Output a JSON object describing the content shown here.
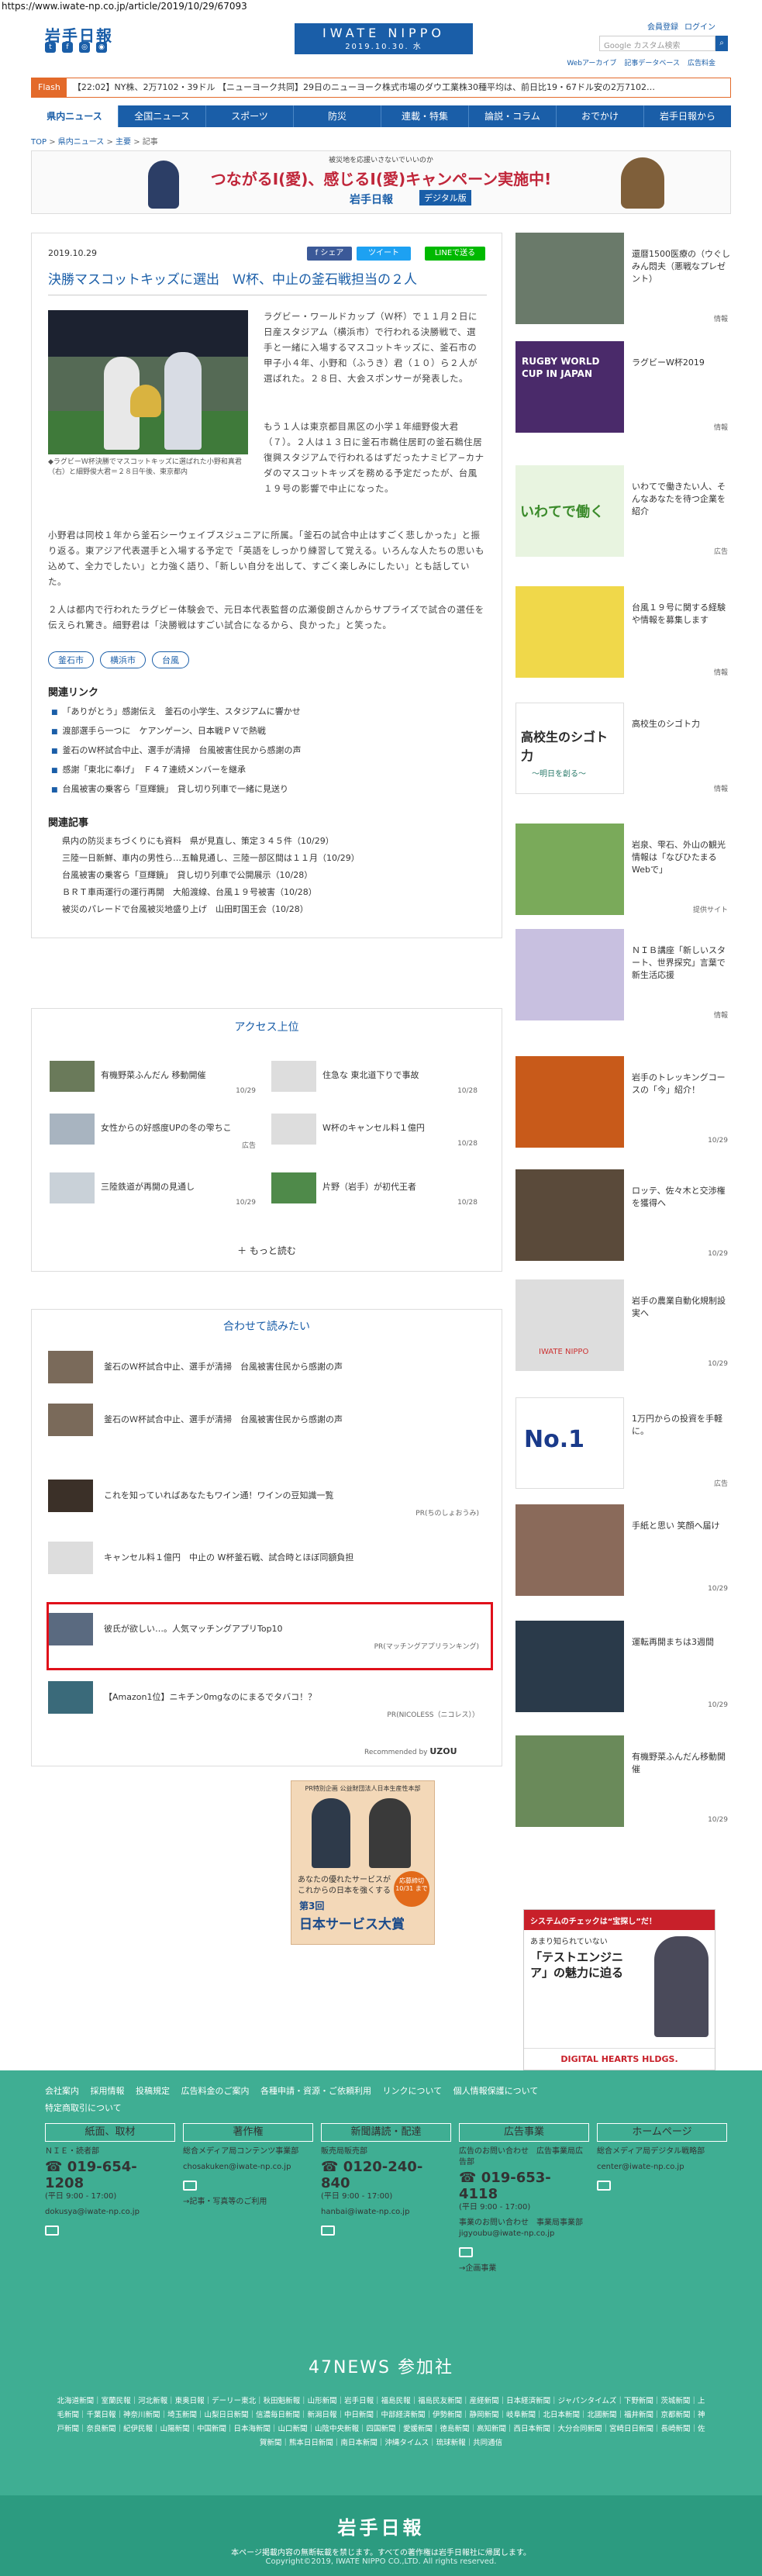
{
  "url": "https://www.iwate-np.co.jp/article/2019/10/29/67093",
  "header": {
    "logo": "岩手日報",
    "brand": "IWATE NIPPO",
    "date": "2019.10.30. 水",
    "member": "会員登録",
    "login": "ログイン",
    "search_placeholder": "Google カスタム検索",
    "tiny_links": [
      "Webアーカイブ",
      "記事データベース",
      "広告料金"
    ]
  },
  "flash": {
    "label": "Flash",
    "text": "【22:02】NY株、2万7102・39ドル 【ニューヨーク共同】29日のニューヨーク株式市場のダウ工業株30種平均は、前日比19・67ドル安の2万7102…"
  },
  "nav": [
    "県内ニュース",
    "全国ニュース",
    "スポーツ",
    "防災",
    "連載・特集",
    "論説・コラム",
    "おでかけ",
    "岩手日報から"
  ],
  "breadcrumb": [
    "TOP",
    "県内ニュース",
    "主要",
    "記事"
  ],
  "banner": {
    "small": "被災地を応援いさないでいいのか",
    "big": "つながるI(愛)、感じるI(愛)キャンペーン実施中!",
    "sub": "岩手日報",
    "sub2": "デジタル版"
  },
  "article": {
    "date": "2019.10.29",
    "share_fb": "f シェア",
    "share_tw": "ツイート",
    "share_line": "LINEで送る",
    "title": "決勝マスコットキッズに選出　Ｗ杯、中止の釜石戦担当の２人",
    "caption": "◆ラグビーＷ杯決勝でマスコットキッズに選ばれた小野和真君（右）と細野俊大君＝２８日午後、東京都内",
    "p1": "ラグビー・ワールドカップ（Ｗ杯）で１１月２日に日産スタジアム（横浜市）で行われる決勝戦で、選手と一緒に入場するマスコットキッズに、釜石市の甲子小４年、小野和（ふうき）君（１０）ら２人が選ばれた。２８日、大会スポンサーが発表した。",
    "p2": "もう１人は東京都目黒区の小学１年細野俊大君（７）。２人は１３日に釜石市鵜住居町の釜石鵜住居復興スタジアムで行われるはずだったナミビア−カナダのマスコットキッズを務める予定だったが、台風１９号の影響で中止になった。",
    "p3": "小野君は同校１年から釜石シーウェイブスジュニアに所属。「釜石の試合中止はすごく悲しかった」と振り返る。東アジア代表選手と入場する予定で「英語をしっかり練習して覚える。いろんな人たちの思いも込めて、全力でしたい」と力強く語り、「新しい自分を出して、すごく楽しみにしたい」とも話していた。",
    "p4": "２人は都内で行われたラグビー体験会で、元日本代表監督の広瀬俊朗さんからサプライズで試合の選任を伝えられ驚き。細野君は「決勝戦はすごい試合になるから、良かった」と笑った。",
    "tags": [
      "釜石市",
      "横浜市",
      "台風"
    ]
  },
  "related_links": {
    "heading": "関連リンク",
    "items": [
      "「ありがとう」感謝伝え　釜石の小学生、スタジアムに響かせ",
      "渡部選手ら一つに　ケアンゲーン、日本戦ＰＶで熱戦",
      "釜石のＷ杯試合中止、選手が清掃　台風被害住民から感謝の声",
      "感謝「東北に奉げ」　Ｆ４７連続メンバーを継承",
      "台風被害の乗客ら「亘輝鏡」　貸し切り列車で一緒に見送り"
    ]
  },
  "related_articles": {
    "heading": "関連記事",
    "items": [
      "県内の防災まちづくりにも資料　県が見直し、策定３４５件（10/29）",
      "三陸一日新鮮、車内の男性ら…五輪見通し、三陸一部区間は１１月（10/29）",
      "台風被害の乗客ら「亘輝鏡」　貸し切り列車で公開展示（10/28）",
      "ＢＲＴ車両運行の運行再開　大船渡線、台風１９号被害（10/28）",
      "被災のパレードで台風被災地盛り上げ　山田町国王会（10/28）"
    ]
  },
  "access": {
    "heading": "アクセス上位",
    "items": [
      {
        "text": "有機野菜ふんだん 移動開催",
        "date": "10/29"
      },
      {
        "text": "住急な 東北道下りで事故",
        "date": "10/28"
      },
      {
        "text": "女性からの好感度UPの冬の雫ちこ",
        "date": "広告"
      },
      {
        "text": "W杯のキャンセル料１億円",
        "date": "10/28"
      },
      {
        "text": "三陸鉄道が再開の見通し",
        "date": "10/29"
      },
      {
        "text": "片野（岩手）が初代王者",
        "date": "10/28"
      }
    ],
    "more": "もっと読む"
  },
  "recommend": {
    "heading": "合わせて読みたい",
    "items": [
      {
        "text": "釜石のＷ杯試合中止、選手が清掃　台風被害住民から感謝の声",
        "pr": ""
      },
      {
        "text": "釜石のＷ杯試合中止、選手が清掃　台風被害住民から感謝の声",
        "pr": ""
      },
      {
        "text": "これを知っていればあなたもワイン通！ワインの豆知識一覧",
        "pr": "PR(ちのしょおうみ)"
      },
      {
        "text": "キャンセル料１億円　中止の W杯釜石戦、試合時とほぼ同額負担",
        "pr": ""
      },
      {
        "text": "彼氏が欲しい…。人気マッチングアプリTop10",
        "pr": "PR(マッチングアプリランキング)"
      },
      {
        "text": "【Amazon1位】ニキチン0mgなのにまるでタバコ！？",
        "pr": "PR(NICOLESS（ニコレス））"
      }
    ],
    "powered": "Recommended by",
    "powered_brand": "UZOU"
  },
  "ad_bottom": {
    "top": "PR特別企画 公益財団法人日本生産性本部",
    "line1": "あなたの優れたサービスが",
    "line2": "これからの日本を強くする",
    "award_num": "第3回",
    "award": "日本サービス大賞",
    "deadline": "応募締切 10/31 まで"
  },
  "sidebar": {
    "items": [
      {
        "text": "還暦1500医療の（ウぐしみん悶夫（悪戦なプレゼント）",
        "date": "情報"
      },
      {
        "text": "ラグビーW杯2019",
        "date": "情報"
      },
      {
        "text": "いわてで働きたい人、そんなあなたを待つ企業を紹介",
        "date": "広告"
      },
      {
        "text": "台風１９号に関する経験や情報を募集します",
        "date": "情報"
      },
      {
        "text": "高校生のシゴト力",
        "date": "情報"
      },
      {
        "text": "岩泉、雫石、外山の観光情報は「なびひたまるWebで」",
        "date": "提供サイト"
      },
      {
        "text": "ＮＩＢ講座「新しいスタート、世界探究」言葉で新生活応援",
        "date": "情報"
      },
      {
        "text": "岩手のトレッキングコースの「今」紹介！",
        "date": "10/29"
      },
      {
        "text": "ロッテ、佐々木と交渉権を獲得へ",
        "date": "10/29"
      },
      {
        "text": "岩手の農業自動化規制設実へ",
        "date": "10/29"
      },
      {
        "text": "1万円からの投資を手軽に。",
        "date": "広告"
      },
      {
        "text": "手紙と思い 笑顔へ届け",
        "date": "10/29"
      },
      {
        "text": "運転再開まちは3週間",
        "date": "10/29"
      },
      {
        "text": "有機野菜ふんだん移動開催",
        "date": "10/29"
      }
    ],
    "tile_labels": {
      "rugby": "RUGBY WORLD CUP IN JAPAN",
      "iwate": "いわてで働く",
      "kou": "高校生のシゴト力",
      "kou_sub": "〜明日を創る〜",
      "nippo": "IWATE NIPPO",
      "no1": "No.1"
    },
    "ad": {
      "top": "システムのチェックは“宝探し”だ！",
      "q": "あまり知られていない",
      "title": "「テストエンジニア」の魅力に迫る",
      "brand": "DIGITAL HEARTS HLDGS."
    }
  },
  "footer": {
    "links": [
      "会社案内",
      "採用情報",
      "投稿規定",
      "広告料金のご案内",
      "各種申請・資源・ご依頼利用",
      "リンクについて",
      "個人情報保護について",
      "特定商取引について"
    ],
    "cols": [
      {
        "head": "紙面、取材",
        "sub": "ＮＩＥ・読者部",
        "tel": "019-654-1208",
        "hours": "(平日 9:00 - 17:00)",
        "mail": "dokusya@iwate-np.co.jp"
      },
      {
        "head": "著作権",
        "sub": "総合メディア局コンテンツ事業部",
        "tel": "",
        "hours": "",
        "mail": "chosakuken@iwate-np.co.jp",
        "extra": "→記事・写真等のご利用"
      },
      {
        "head": "新聞講読・配達",
        "sub": "販売局販売部",
        "tel": "0120-240-840",
        "hours": "(平日 9:00 - 17:00)",
        "mail": "hanbai@iwate-np.co.jp"
      },
      {
        "head": "広告事業",
        "sub": "広告のお問い合わせ　広告事業局広告部",
        "tel": "019-653-4118",
        "hours": "(平日 9:00 - 17:00)",
        "mail": "事業のお問い合わせ　事業局事業部 jigyoubu@iwate-np.co.jp",
        "extra": "→企画事業"
      },
      {
        "head": "ホームページ",
        "sub": "総合メディア局デジタル戦略部",
        "tel": "",
        "hours": "",
        "mail": "center@iwate-np.co.jp"
      }
    ],
    "news47": "47NEWS 参加社",
    "papers": "北海道新聞｜室蘭民報｜河北新報｜東奥日報｜デーリー東北｜秋田魁新報｜山形新聞｜岩手日報｜福島民報｜福島民友新聞｜産経新聞｜日本経済新聞｜ジャパンタイムズ｜下野新聞｜茨城新聞｜上毛新聞｜千葉日報｜神奈川新聞｜埼玉新聞｜山梨日日新聞｜信濃毎日新聞｜新潟日報｜中日新聞｜中部経済新聞｜伊勢新聞｜静岡新聞｜岐阜新聞｜北日本新聞｜北國新聞｜福井新聞｜京都新聞｜神戸新聞｜奈良新聞｜紀伊民報｜山陽新聞｜中国新聞｜日本海新聞｜山口新聞｜山陰中央新報｜四国新聞｜愛媛新聞｜徳島新聞｜高知新聞｜西日本新聞｜大分合同新聞｜宮崎日日新聞｜長崎新聞｜佐賀新聞｜熊本日日新聞｜南日本新聞｜沖縄タイムス｜琉球新報｜共同通信",
    "logo": "岩手日報",
    "notice": "本ページ掲載内容の無断転載を禁じます。すべての著作権は岩手日報社に帰属します。",
    "copyright": "Copyright©2019, IWATE NIPPO CO.,LTD. All rights reserved."
  },
  "colors": {
    "brand": "#1a5ea8",
    "footer": "#3fae93",
    "highlight": "#e0101a",
    "flash": "#e36a2a"
  }
}
